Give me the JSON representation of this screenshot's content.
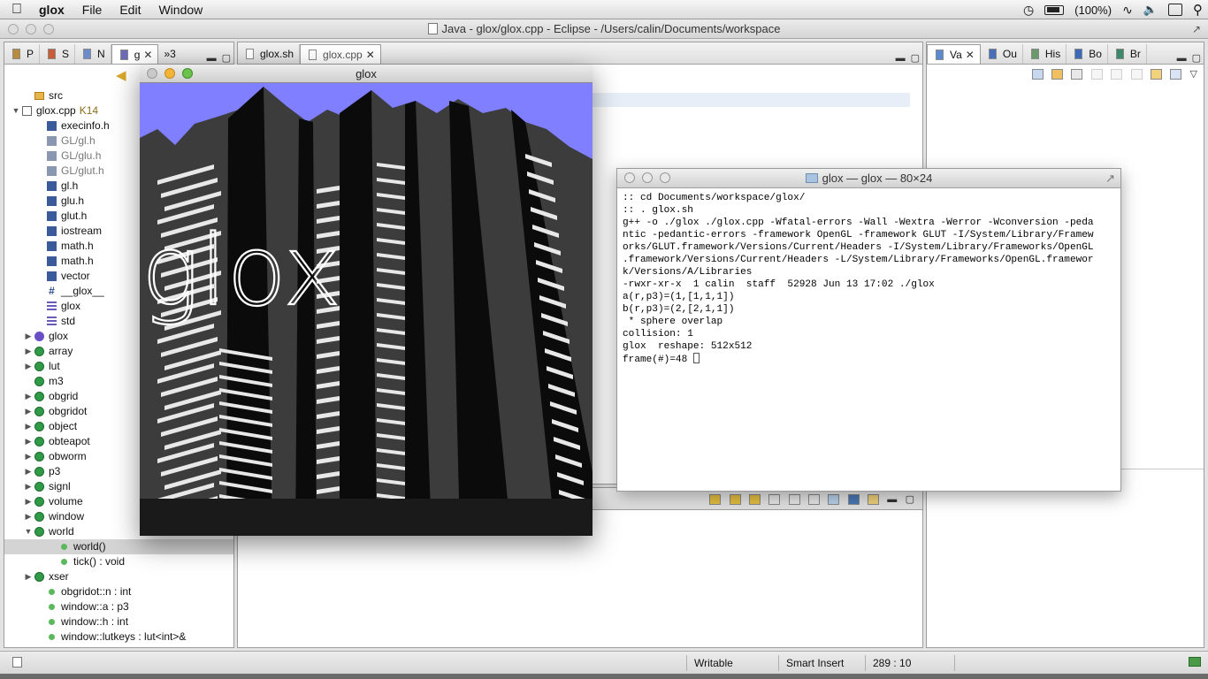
{
  "menubar": {
    "app": "glox",
    "items": [
      "File",
      "Edit",
      "Window"
    ],
    "battery": "(100%)"
  },
  "window": {
    "title": "Java - glox/glox.cpp - Eclipse - /Users/calin/Documents/workspace"
  },
  "left_panel": {
    "tabs": [
      {
        "label": "P"
      },
      {
        "label": "S"
      },
      {
        "label": "N"
      },
      {
        "label": "g"
      },
      {
        "label": "»3"
      }
    ],
    "tree": [
      {
        "indent": 1,
        "twisty": "",
        "icon": "folder",
        "label": "src",
        "grey": false
      },
      {
        "indent": 0,
        "twisty": "▼",
        "icon": "file",
        "label": "glox.cpp",
        "badge": "K14",
        "grey": false
      },
      {
        "indent": 2,
        "twisty": "",
        "icon": "header",
        "label": "execinfo.h",
        "grey": false
      },
      {
        "indent": 2,
        "twisty": "",
        "icon": "header-grey",
        "label": "GL/gl.h",
        "grey": true
      },
      {
        "indent": 2,
        "twisty": "",
        "icon": "header-grey",
        "label": "GL/glu.h",
        "grey": true
      },
      {
        "indent": 2,
        "twisty": "",
        "icon": "header-grey",
        "label": "GL/glut.h",
        "grey": true
      },
      {
        "indent": 2,
        "twisty": "",
        "icon": "header",
        "label": "gl.h",
        "grey": false
      },
      {
        "indent": 2,
        "twisty": "",
        "icon": "header",
        "label": "glu.h",
        "grey": false
      },
      {
        "indent": 2,
        "twisty": "",
        "icon": "header",
        "label": "glut.h",
        "grey": false
      },
      {
        "indent": 2,
        "twisty": "",
        "icon": "header",
        "label": "iostream",
        "grey": false
      },
      {
        "indent": 2,
        "twisty": "",
        "icon": "header",
        "label": "math.h",
        "grey": false
      },
      {
        "indent": 2,
        "twisty": "",
        "icon": "header",
        "label": "math.h",
        "grey": false
      },
      {
        "indent": 2,
        "twisty": "",
        "icon": "header",
        "label": "vector",
        "grey": false
      },
      {
        "indent": 2,
        "twisty": "",
        "icon": "define",
        "label": "__glox__",
        "grey": false
      },
      {
        "indent": 2,
        "twisty": "",
        "icon": "namespace",
        "label": "glox",
        "grey": false
      },
      {
        "indent": 2,
        "twisty": "",
        "icon": "namespace",
        "label": "std",
        "grey": false
      },
      {
        "indent": 1,
        "twisty": "▶",
        "icon": "namespace-n",
        "label": "glox",
        "grey": false
      },
      {
        "indent": 1,
        "twisty": "▶",
        "icon": "class",
        "label": "array",
        "grey": false
      },
      {
        "indent": 1,
        "twisty": "▶",
        "icon": "class",
        "label": "lut",
        "grey": false
      },
      {
        "indent": 1,
        "twisty": "",
        "icon": "class",
        "label": "m3",
        "grey": false
      },
      {
        "indent": 1,
        "twisty": "▶",
        "icon": "class",
        "label": "obgrid",
        "grey": false
      },
      {
        "indent": 1,
        "twisty": "▶",
        "icon": "class",
        "label": "obgridot",
        "grey": false
      },
      {
        "indent": 1,
        "twisty": "▶",
        "icon": "class",
        "label": "object",
        "grey": false
      },
      {
        "indent": 1,
        "twisty": "▶",
        "icon": "class",
        "label": "obteapot",
        "grey": false
      },
      {
        "indent": 1,
        "twisty": "▶",
        "icon": "class",
        "label": "obworm",
        "grey": false
      },
      {
        "indent": 1,
        "twisty": "▶",
        "icon": "class",
        "label": "p3",
        "grey": false
      },
      {
        "indent": 1,
        "twisty": "▶",
        "icon": "class",
        "label": "signl",
        "grey": false
      },
      {
        "indent": 1,
        "twisty": "▶",
        "icon": "class",
        "label": "volume",
        "grey": false
      },
      {
        "indent": 1,
        "twisty": "▶",
        "icon": "class",
        "label": "window",
        "grey": false
      },
      {
        "indent": 1,
        "twisty": "▼",
        "icon": "class",
        "label": "world",
        "grey": false
      },
      {
        "indent": 3,
        "twisty": "",
        "icon": "method",
        "label": "world()",
        "grey": false,
        "selected": true
      },
      {
        "indent": 3,
        "twisty": "",
        "icon": "method",
        "label": "tick() : void",
        "grey": false
      },
      {
        "indent": 1,
        "twisty": "▶",
        "icon": "class",
        "label": "xser",
        "grey": false
      },
      {
        "indent": 2,
        "twisty": "",
        "icon": "method",
        "label": "obgridot::n : int",
        "grey": false
      },
      {
        "indent": 2,
        "twisty": "",
        "icon": "method",
        "label": "window::a : p3",
        "grey": false
      },
      {
        "indent": 2,
        "twisty": "",
        "icon": "method",
        "label": "window::h : int",
        "grey": false
      },
      {
        "indent": 2,
        "twisty": "",
        "icon": "method",
        "label": "window::lutkeys : lut<int>&",
        "grey": false
      }
    ]
  },
  "editor": {
    "tabs": [
      {
        "label": "glox.sh"
      },
      {
        "label": "glox.cpp"
      }
    ]
  },
  "right_panel": {
    "tabs": [
      {
        "label": "Va"
      },
      {
        "label": "Ou"
      },
      {
        "label": "His"
      },
      {
        "label": "Bo"
      },
      {
        "label": "Br"
      }
    ]
  },
  "glox_window": {
    "title": "glox",
    "overlay_text": "glox",
    "colors": {
      "sky": "#7f7fff",
      "building": "#3c3c3c",
      "shadow": "#0b0b0b",
      "stripe": "#e8e8e8"
    }
  },
  "terminal": {
    "title": "glox — glox — 80×24",
    "lines": [
      ":: cd Documents/workspace/glox/",
      ":: . glox.sh",
      "g++ -o ./glox ./glox.cpp -Wfatal-errors -Wall -Wextra -Werror -Wconversion -peda",
      "ntic -pedantic-errors -framework OpenGL -framework GLUT -I/System/Library/Framew",
      "orks/GLUT.framework/Versions/Current/Headers -I/System/Library/Frameworks/OpenGL",
      ".framework/Versions/Current/Headers -L/System/Library/Frameworks/OpenGL.framewor",
      "k/Versions/A/Libraries",
      "-rwxr-xr-x  1 calin  staff  52928 Jun 13 17:02 ./glox",
      "a(r,p3)=(1,[1,1,1])",
      "b(r,p3)=(2,[2,1,1])",
      " * sphere overlap",
      "collision: 1",
      "glox  reshape: 512x512",
      "frame(#)=48 "
    ]
  },
  "statusbar": {
    "writable": "Writable",
    "insert_mode": "Smart Insert",
    "position": "289 : 10"
  }
}
